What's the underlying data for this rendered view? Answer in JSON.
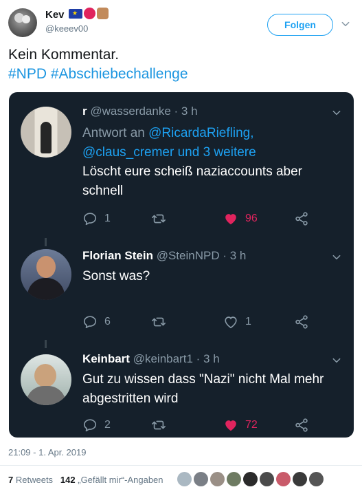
{
  "author": {
    "display_name": "Kev",
    "handle": "@keeev00",
    "follow_label": "Folgen"
  },
  "tweet": {
    "text": "Kein Kommentar.",
    "hashtags": "#NPD #Abschiebechallenge"
  },
  "card": {
    "replies": [
      {
        "name": "r",
        "handle": "@wasserdanke",
        "time": "· 3 h",
        "reply_to_prefix": "Antwort an",
        "reply_to_user": "@RicardaRiefling,",
        "reply_to_more": "@claus_cremer und 3 weitere",
        "text": "Löscht eure scheiß naziaccounts aber schnell",
        "replies_count": "1",
        "retweets_count": "",
        "likes_count": "96",
        "liked": true
      },
      {
        "name": "Florian Stein",
        "handle": "@SteinNPD",
        "time": "· 3 h",
        "text": "Sonst was?",
        "replies_count": "6",
        "retweets_count": "",
        "likes_count": "1",
        "liked": false
      },
      {
        "name": "Keinbart",
        "handle": "@keinbart1",
        "time": "· 3 h",
        "text": "Gut zu wissen dass \"Nazi\" nicht Mal mehr abgestritten wird",
        "replies_count": "2",
        "retweets_count": "",
        "likes_count": "72",
        "liked": true
      }
    ]
  },
  "footer": {
    "timestamp": "21:09 - 1. Apr. 2019",
    "retweets_count": "7",
    "retweets_label": "Retweets",
    "likes_count": "142",
    "likes_label": "„Gefällt mir“-Angaben"
  },
  "colors": {
    "accent": "#1da1f2",
    "card_bg": "#15202b",
    "like": "#e0245e",
    "muted": "#8899a6"
  },
  "icons": {
    "reply": "reply-icon",
    "retweet": "retweet-icon",
    "like": "heart-icon",
    "share": "share-icon",
    "caret": "chevron-down-icon"
  }
}
